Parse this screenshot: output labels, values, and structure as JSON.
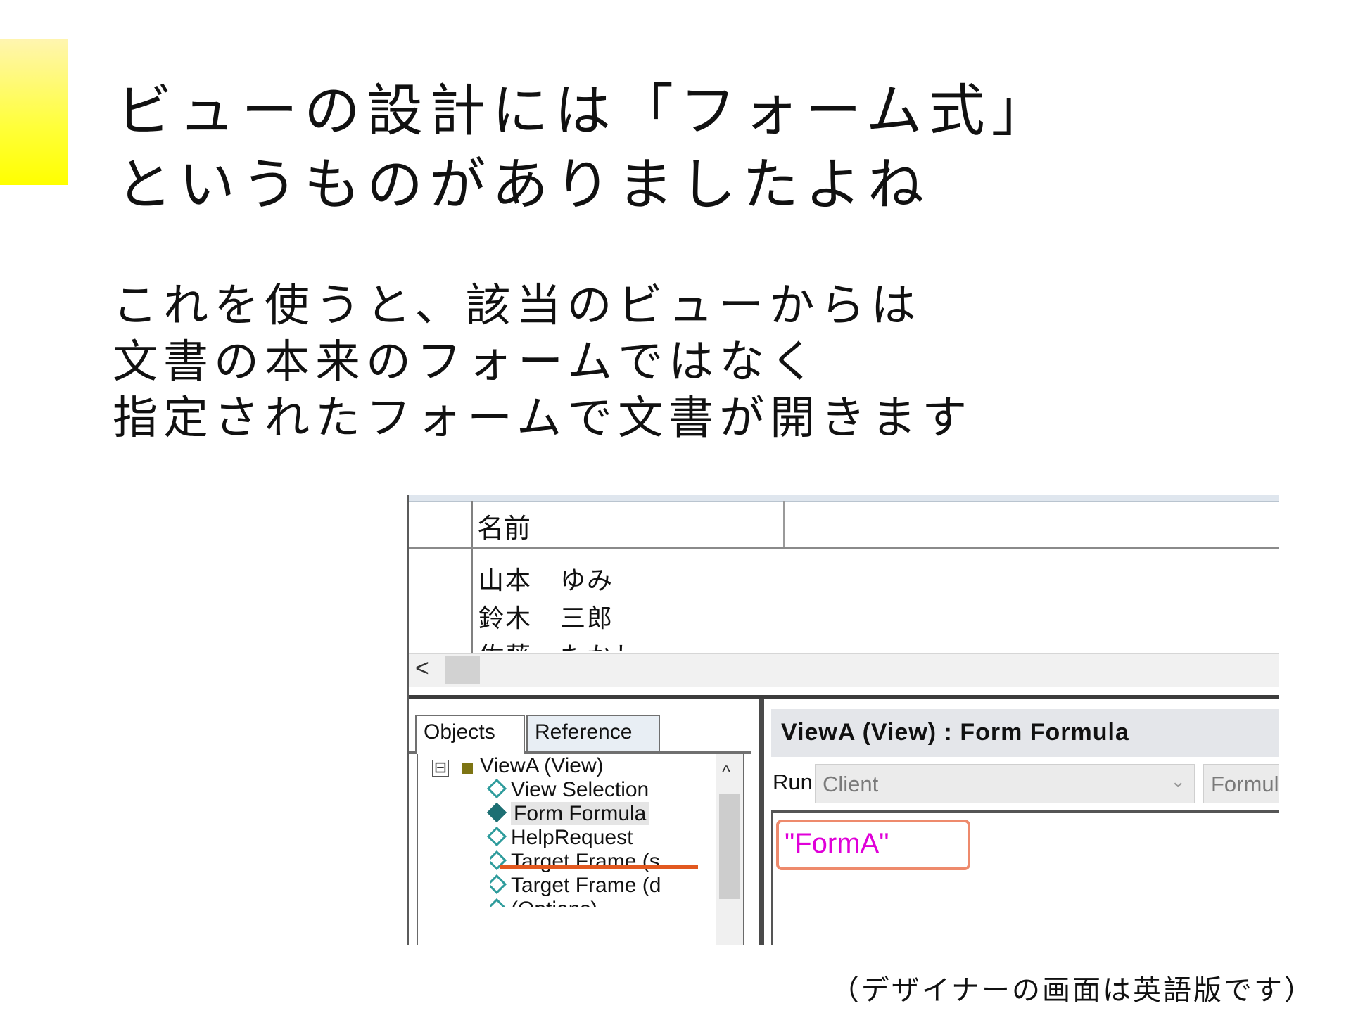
{
  "title": {
    "line1": "ビューの設計には「フォーム式」",
    "line2": "というものがありましたよね"
  },
  "body": {
    "line1": "これを使うと、該当のビューからは",
    "line2": "文書の本来のフォームではなく",
    "line3": "指定されたフォームで文書が開きます"
  },
  "caption": "（デザイナーの画面は英語版です）",
  "screenshot": {
    "view_preview": {
      "column_header": "名前",
      "rows": [
        {
          "last": "山本",
          "first": "ゆみ"
        },
        {
          "last": "鈴木",
          "first": "三郎"
        },
        {
          "last": "佐藤",
          "first": "たかし"
        }
      ],
      "scroll_left": "<"
    },
    "tabs": {
      "objects": "Objects",
      "reference": "Reference"
    },
    "tree": {
      "expander": "⊟",
      "root": "ViewA (View)",
      "items": [
        "View Selection",
        "Form Formula",
        "HelpRequest",
        "Target Frame (s",
        "Target Frame (d",
        "(Options)"
      ],
      "selected_item": "Form Formula",
      "scroll_up": "^"
    },
    "editor_panel": {
      "title": "ViewA (View) : Form Formula",
      "run_label": "Run",
      "run_value": "Client",
      "second_value": "Formula",
      "code": "\"FormA\""
    },
    "colors": {
      "accent_yellow": "#ffff00",
      "code_magenta": "#e000d8",
      "highlight_orange": "#ee8a6c",
      "underline_orange": "#e2581f",
      "diamond_teal": "#2e9c9c"
    },
    "icons": [
      "expander-icon",
      "view-icon",
      "diamond-outline-icon",
      "diamond-filled-icon",
      "chevron-down-icon",
      "scroll-left-icon",
      "scroll-up-icon"
    ]
  }
}
